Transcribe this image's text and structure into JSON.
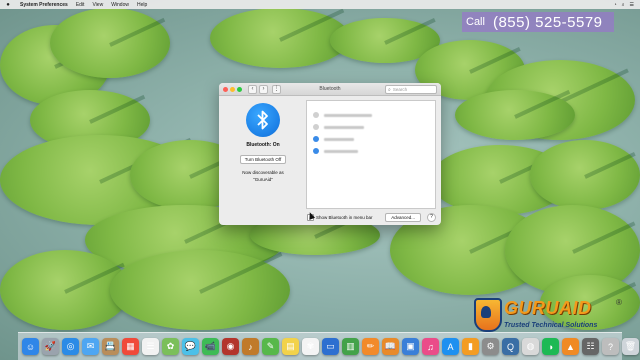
{
  "menubar": {
    "apple_icon": "apple-icon",
    "items": [
      {
        "label": "System Preferences",
        "bold": true
      },
      {
        "label": "Edit"
      },
      {
        "label": "View"
      },
      {
        "label": "Window"
      },
      {
        "label": "Help"
      }
    ]
  },
  "banner": {
    "call_label": "Call",
    "phone": "(855)  525-5579"
  },
  "window": {
    "title": "Bluetooth",
    "search_placeholder": "Search",
    "bluetooth_status": "Bluetooth: On",
    "toggle_button": "Turn Bluetooth Off",
    "discoverable_note": "Now discoverable as",
    "device_name": "\"GuruAid\"",
    "show_in_menu_bar": "Show Bluetooth in menu bar",
    "advanced_button": "Advanced...",
    "help_button": "?",
    "devices": [
      {
        "icon": "device-gray-icon",
        "icon_color": "#d0d0d0"
      },
      {
        "icon": "device-gray-icon",
        "icon_color": "#d0d0d0"
      },
      {
        "icon": "device-blue-icon",
        "icon_color": "#3a8be8"
      },
      {
        "icon": "device-blue-icon",
        "icon_color": "#3a8be8"
      }
    ]
  },
  "logo": {
    "brand": "GURUAID",
    "registered": "®",
    "tagline": "Trusted Technical Solutions"
  },
  "dock": [
    {
      "name": "finder-icon",
      "color": "#2f86e8",
      "glyph": "☺"
    },
    {
      "name": "launchpad-icon",
      "color": "#9aa3ad",
      "glyph": "🚀"
    },
    {
      "name": "safari-icon",
      "color": "#2b8be6",
      "glyph": "◎"
    },
    {
      "name": "mail-icon",
      "color": "#4ea6f2",
      "glyph": "✉"
    },
    {
      "name": "contacts-icon",
      "color": "#b98d5a",
      "glyph": "📇"
    },
    {
      "name": "calendar-icon",
      "color": "#f04a3a",
      "glyph": "▦"
    },
    {
      "name": "reminders-icon",
      "color": "#f2f2f2",
      "glyph": "☰"
    },
    {
      "name": "photo-icon",
      "color": "#7bbf5a",
      "glyph": "✿"
    },
    {
      "name": "messages-icon",
      "color": "#4cc0e8",
      "glyph": "💬"
    },
    {
      "name": "facetime-icon",
      "color": "#3dbb55",
      "glyph": "📹"
    },
    {
      "name": "photo-booth-icon",
      "color": "#b3352c",
      "glyph": "◉"
    },
    {
      "name": "garageband-icon",
      "color": "#c07a2a",
      "glyph": "♪"
    },
    {
      "name": "evernote-icon",
      "color": "#57b84a",
      "glyph": "✎"
    },
    {
      "name": "notes-icon",
      "color": "#f2d24a",
      "glyph": "▤"
    },
    {
      "name": "photos-icon",
      "color": "#f4f4f4",
      "glyph": "✾"
    },
    {
      "name": "keynote-icon",
      "color": "#2d6fd0",
      "glyph": "▭"
    },
    {
      "name": "numbers-icon",
      "color": "#43a24a",
      "glyph": "▥"
    },
    {
      "name": "pages-icon",
      "color": "#f28a2a",
      "glyph": "✏"
    },
    {
      "name": "books-icon",
      "color": "#e88a2a",
      "glyph": "📖"
    },
    {
      "name": "preview-icon",
      "color": "#3a7fd8",
      "glyph": "▣"
    },
    {
      "name": "itunes-icon",
      "color": "#ea4c89",
      "glyph": "♫"
    },
    {
      "name": "app-store-icon",
      "color": "#1e90f0",
      "glyph": "A"
    },
    {
      "name": "ibooks-icon",
      "color": "#f39c22",
      "glyph": "▮"
    },
    {
      "name": "system-preferences-icon",
      "color": "#8c8c8c",
      "glyph": "⚙"
    },
    {
      "name": "quicktime-icon",
      "color": "#3a6ea5",
      "glyph": "Q"
    },
    {
      "name": "chrome-icon",
      "color": "#d9d9d9",
      "glyph": "◍"
    },
    {
      "name": "spotify-icon",
      "color": "#1db954",
      "glyph": "◑"
    },
    {
      "name": "vlc-icon",
      "color": "#f08a24",
      "glyph": "▲"
    },
    {
      "name": "ibooks-author-icon",
      "color": "#666",
      "glyph": "☷"
    },
    {
      "name": "help-icon",
      "color": "#bdbdbd",
      "glyph": "?"
    },
    {
      "name": "trash-icon",
      "color": "#cfd5da",
      "glyph": "🗑"
    }
  ]
}
